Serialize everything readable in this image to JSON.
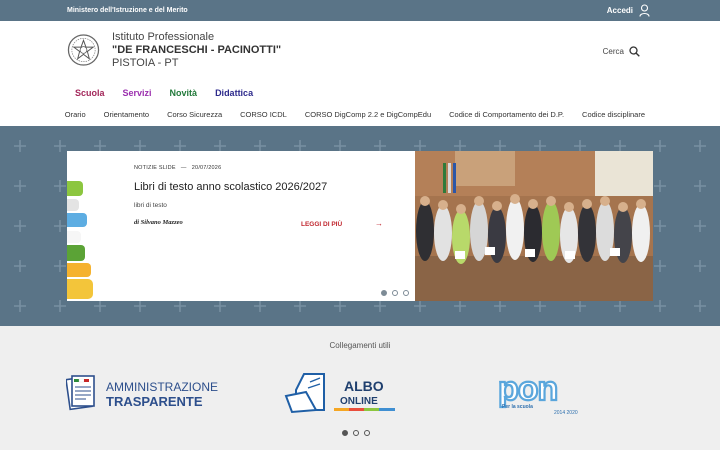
{
  "topbar": {
    "ministry": "Ministero dell'Istruzione e del Merito",
    "login": "Accedi",
    "login_icon": "user-icon"
  },
  "header": {
    "line1": "Istituto Professionale",
    "line2": "\"DE FRANCESCHI - PACINOTTI\"",
    "line3": "PISTOIA - PT",
    "search_label": "Cerca",
    "search_icon": "search-icon"
  },
  "mainnav": [
    {
      "label": "Scuola",
      "color": "#a3285b"
    },
    {
      "label": "Servizi",
      "color": "#9b2fae"
    },
    {
      "label": "Novità",
      "color": "#237a3b"
    },
    {
      "label": "Didattica",
      "color": "#2d2a8c"
    }
  ],
  "subnav": [
    "Orario",
    "Orientamento",
    "Corso Sicurezza",
    "CORSO ICDL",
    "CORSO DigComp 2.2 e DigCompEdu",
    "Codice di Comportamento dei D.P.",
    "Codice disciplinare"
  ],
  "slide": {
    "category": "NOTIZIE SLIDE",
    "separator": "—",
    "date": "20/07/2026",
    "title": "Libri di testo anno scolastico 2026/2027",
    "tag": "libri di testo",
    "author": "di Silvano Mazzeo",
    "more": "LEGGI DI PIÙ",
    "arrow": "→"
  },
  "links": {
    "title": "Collegamenti utili",
    "amm_line1": "AMMINISTRAZIONE",
    "amm_line2": "TRASPARENTE",
    "albo_line1": "ALBO",
    "albo_line2": "ONLINE",
    "pon_text": "pon",
    "pon_sub": "Per la scuola",
    "pon_years": "2014 2020"
  },
  "colors": {
    "bar": "#5a7487",
    "accent": "#c0262e",
    "albo_blue": "#1f5fa6"
  }
}
